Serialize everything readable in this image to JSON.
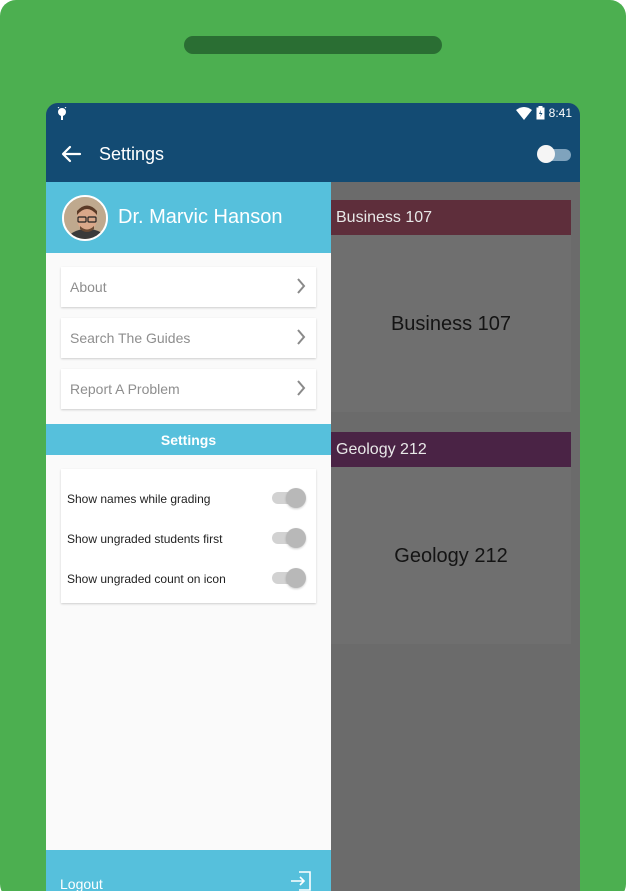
{
  "status": {
    "time": "8:41"
  },
  "appbar": {
    "title": "Settings"
  },
  "drawer": {
    "user_name": "Dr. Marvic Hanson",
    "menu": [
      {
        "label": "About"
      },
      {
        "label": "Search The Guides"
      },
      {
        "label": "Report A Problem"
      }
    ],
    "settings_title": "Settings",
    "settings": [
      {
        "label": "Show names while grading",
        "on": true
      },
      {
        "label": "Show ungraded students first",
        "on": true
      },
      {
        "label": "Show ungraded count on icon",
        "on": true
      }
    ],
    "logout": "Logout"
  },
  "cards": [
    {
      "header": "Business 107",
      "title": "Business 107",
      "color": "#5e2e3b"
    },
    {
      "header": "Geology 212",
      "title": "Geology 212",
      "color": "#4a2345"
    }
  ],
  "colors": {
    "device_green": "#4caf50",
    "toolbar_blue": "#134b73",
    "drawer_accent": "#56c0dc"
  }
}
